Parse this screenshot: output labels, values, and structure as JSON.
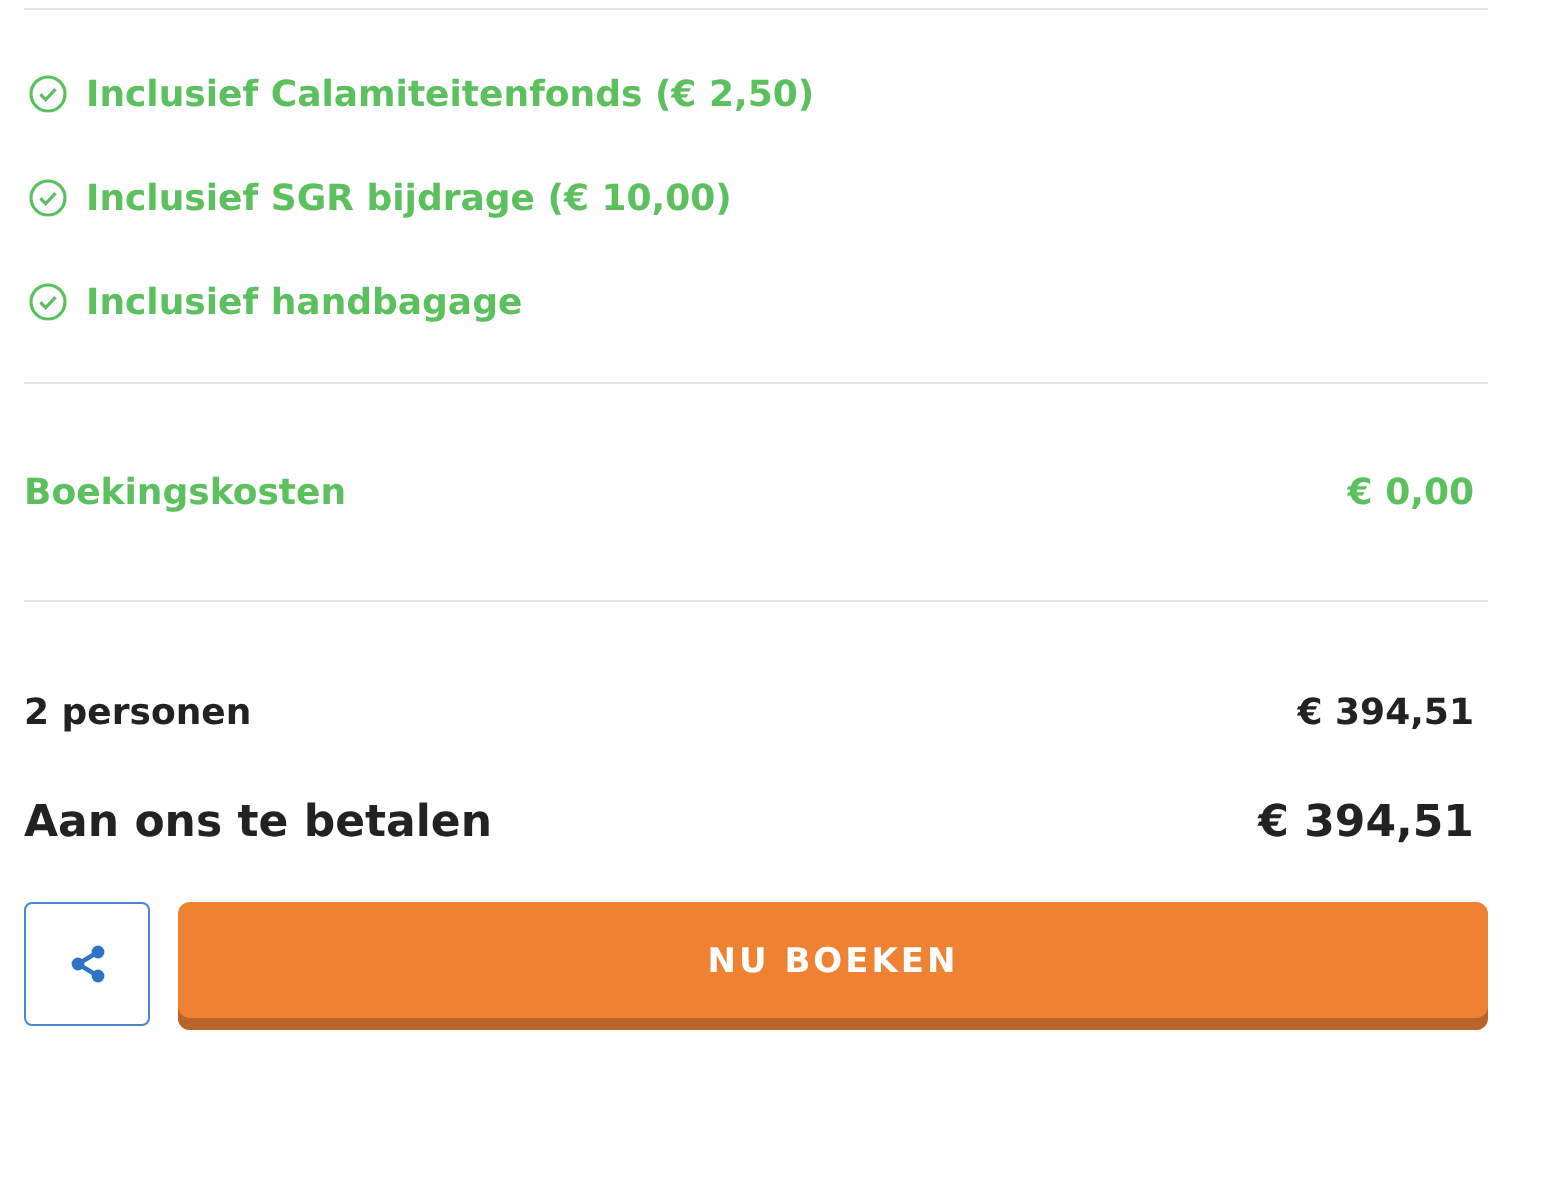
{
  "inclusions": [
    {
      "label": "Inclusief Calamiteitenfonds (€ 2,50)"
    },
    {
      "label": "Inclusief SGR bijdrage (€ 10,00)"
    },
    {
      "label": "Inclusief handbagage"
    }
  ],
  "booking_fee": {
    "label": "Boekingskosten",
    "amount": "€ 0,00"
  },
  "persons": {
    "label": "2 personen",
    "amount": "€ 394,51"
  },
  "total": {
    "label": "Aan ons te betalen",
    "amount": "€ 394,51"
  },
  "book_button": "NU BOEKEN"
}
